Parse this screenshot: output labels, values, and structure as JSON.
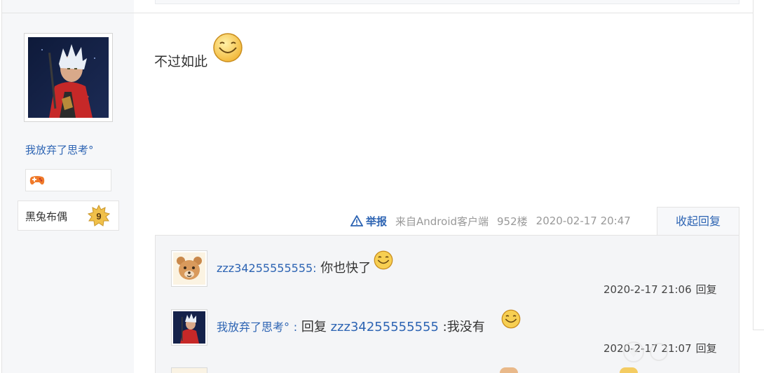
{
  "user_panel": {
    "username": "我放弃了思考°",
    "level_name": "黑兔布偶",
    "level_number": "9"
  },
  "post": {
    "content": "不过如此",
    "report_label": "举报",
    "source": "来自Android客户端",
    "floor": "952楼",
    "datetime": "2020-02-17 20:47",
    "collapse_label": "收起回复"
  },
  "replies": [
    {
      "user": "zzz34255555555",
      "separator": ":",
      "text": "你也快了",
      "time": "2020-2-17 21:06",
      "action": "回复"
    },
    {
      "user": "我放弃了思考°",
      "separator": ":",
      "reply_prefix": "回复",
      "reply_target": "zzz34255555555",
      "text": ":我没有",
      "time": "2020-2-17 21:07",
      "action": "回复"
    }
  ],
  "colors": {
    "link": "#2d64b3",
    "muted": "#999999",
    "reply_bg": "#f4f5f7"
  },
  "icons": {
    "report": "warning-triangle-icon",
    "emoji": "smile-emoji-icon",
    "badge": "game-controller-icon",
    "level": "star-level-icon"
  }
}
